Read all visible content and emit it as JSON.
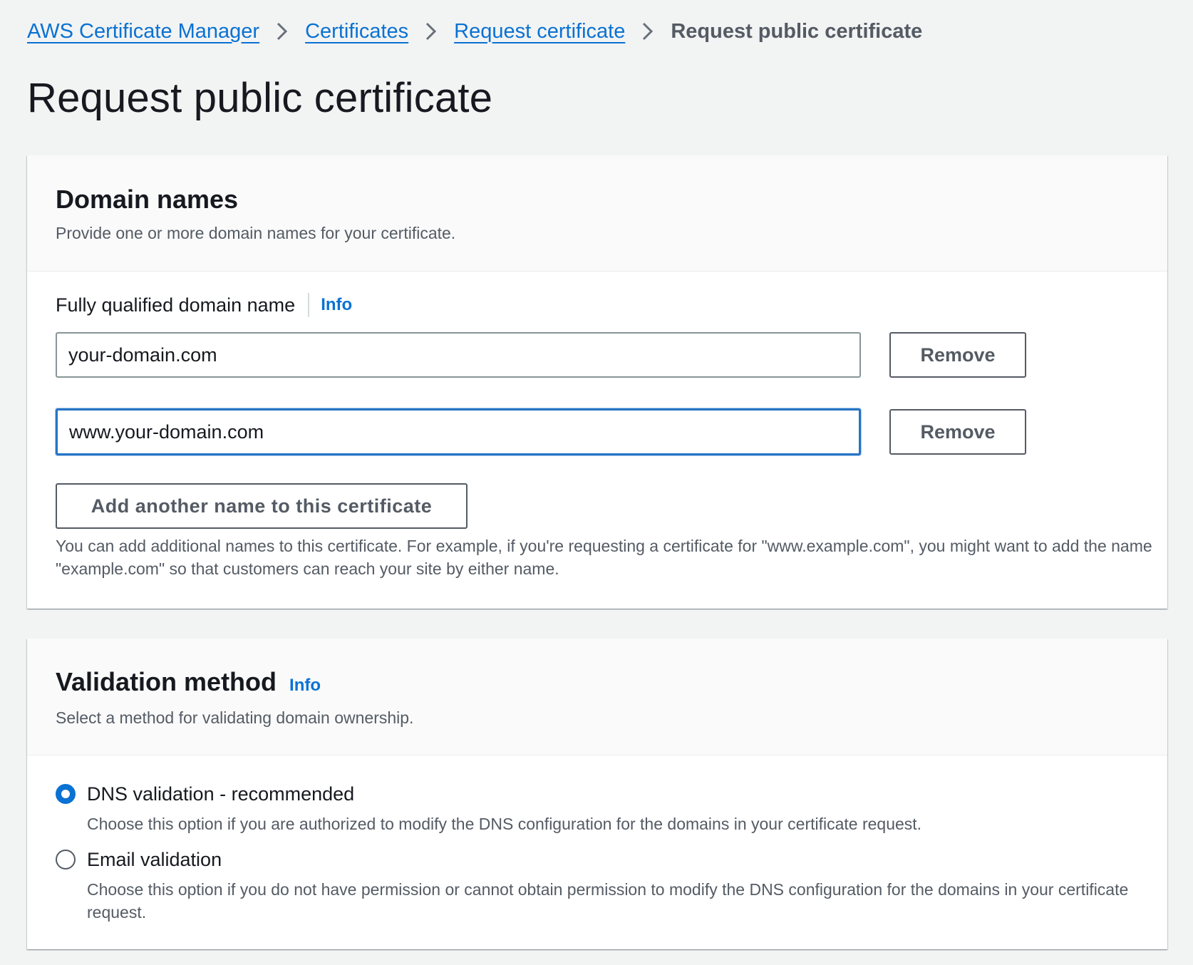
{
  "breadcrumb": {
    "items": [
      "AWS Certificate Manager",
      "Certificates",
      "Request certificate"
    ],
    "current": "Request public certificate"
  },
  "page_title": "Request public certificate",
  "domain_names": {
    "title": "Domain names",
    "description": "Provide one or more domain names for your certificate.",
    "field_label": "Fully qualified domain name",
    "info_label": "Info",
    "inputs": [
      {
        "value": "your-domain.com",
        "focused": false
      },
      {
        "value": "www.your-domain.com",
        "focused": true
      }
    ],
    "remove_label": "Remove",
    "add_label": "Add another name to this certificate",
    "hint": "You can add additional names to this certificate. For example, if you're requesting a certificate for \"www.example.com\", you might want to add the name \"example.com\" so that customers can reach your site by either name."
  },
  "validation": {
    "title": "Validation method",
    "info_label": "Info",
    "description": "Select a method for validating domain ownership.",
    "options": [
      {
        "label": "DNS validation - recommended",
        "description": "Choose this option if you are authorized to modify the DNS configuration for the domains in your certificate request.",
        "checked": true
      },
      {
        "label": "Email validation",
        "description": "Choose this option if you do not have permission or cannot obtain permission to modify the DNS configuration for the domains in your certificate request.",
        "checked": false
      }
    ]
  },
  "colors": {
    "link": "#0972d3",
    "text": "#16191f",
    "secondary_text": "#545b64",
    "background": "#f2f3f3",
    "focus_border": "#2674c4"
  }
}
